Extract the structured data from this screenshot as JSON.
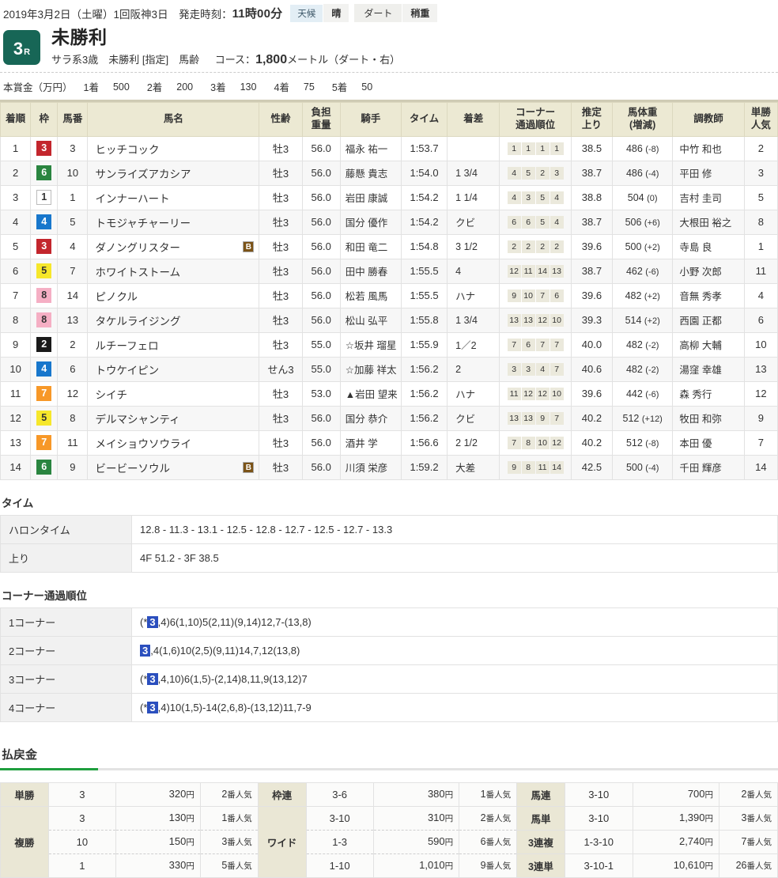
{
  "header": {
    "date_line": "2019年3月2日（土曜）1回阪神3日　発走時刻：",
    "post_time": "11時00分",
    "weather_label": "天候",
    "weather_value": "晴",
    "track_label": "ダート",
    "track_condition": "稍重",
    "race_number": "3",
    "race_number_suffix": "R",
    "race_name": "未勝利",
    "race_sub": "サラ系3歳　未勝利 [指定]　馬齢",
    "course_label": "コース：",
    "course_distance": "1,800",
    "course_unit": "メートル（ダート・右）"
  },
  "prize": {
    "label": "本賞金（万円）",
    "entries": [
      {
        "place": "1着",
        "amount": "500"
      },
      {
        "place": "2着",
        "amount": "200"
      },
      {
        "place": "3着",
        "amount": "130"
      },
      {
        "place": "4着",
        "amount": "75"
      },
      {
        "place": "5着",
        "amount": "50"
      }
    ]
  },
  "result_table": {
    "columns": [
      "着順",
      "枠",
      "馬番",
      "馬名",
      "性齢",
      "負担重量",
      "騎手",
      "タイム",
      "着差",
      "コーナー通過順位",
      "推定上り",
      "馬体重（増減）",
      "調教師",
      "単勝人気"
    ],
    "col_burden_l1": "負担",
    "col_burden_l2": "重量",
    "col_corner_l1": "コーナー",
    "col_corner_l2": "通過順位",
    "col_last_l1": "推定",
    "col_last_l2": "上り",
    "col_bw_l1": "馬体重",
    "col_bw_l2": "(増減)",
    "col_pop_l1": "単勝",
    "col_pop_l2": "人気",
    "rows": [
      {
        "rank": "1",
        "waku": "3",
        "umaban": "3",
        "horse": "ヒッチコック",
        "blinker": "",
        "sex": "牡3",
        "weight": "56.0",
        "jockey": "福永 祐一",
        "time": "1:53.7",
        "margin": "",
        "corner": [
          "1",
          "1",
          "1",
          "1"
        ],
        "last": "38.5",
        "bw": "486",
        "bw_delta": "(-8)",
        "trainer": "中竹 和也",
        "pop": "2"
      },
      {
        "rank": "2",
        "waku": "6",
        "umaban": "10",
        "horse": "サンライズアカシア",
        "blinker": "",
        "sex": "牡3",
        "weight": "56.0",
        "jockey": "藤懸 貴志",
        "time": "1:54.0",
        "margin": "1 3/4",
        "corner": [
          "4",
          "5",
          "2",
          "3"
        ],
        "last": "38.7",
        "bw": "486",
        "bw_delta": "(-4)",
        "trainer": "平田 修",
        "pop": "3"
      },
      {
        "rank": "3",
        "waku": "1",
        "umaban": "1",
        "horse": "インナーハート",
        "blinker": "",
        "sex": "牡3",
        "weight": "56.0",
        "jockey": "岩田 康誠",
        "time": "1:54.2",
        "margin": "1 1/4",
        "corner": [
          "4",
          "3",
          "5",
          "4"
        ],
        "last": "38.8",
        "bw": "504",
        "bw_delta": "(0)",
        "trainer": "吉村 圭司",
        "pop": "5"
      },
      {
        "rank": "4",
        "waku": "4",
        "umaban": "5",
        "horse": "トモジャチャーリー",
        "blinker": "",
        "sex": "牡3",
        "weight": "56.0",
        "jockey": "国分 優作",
        "time": "1:54.2",
        "margin": "クビ",
        "corner": [
          "6",
          "6",
          "5",
          "4"
        ],
        "last": "38.7",
        "bw": "506",
        "bw_delta": "(+6)",
        "trainer": "大根田 裕之",
        "pop": "8"
      },
      {
        "rank": "5",
        "waku": "3",
        "umaban": "4",
        "horse": "ダノングリスター",
        "blinker": "B",
        "sex": "牡3",
        "weight": "56.0",
        "jockey": "和田 竜二",
        "time": "1:54.8",
        "margin": "3 1/2",
        "corner": [
          "2",
          "2",
          "2",
          "2"
        ],
        "last": "39.6",
        "bw": "500",
        "bw_delta": "(+2)",
        "trainer": "寺島 良",
        "pop": "1"
      },
      {
        "rank": "6",
        "waku": "5",
        "umaban": "7",
        "horse": "ホワイトストーム",
        "blinker": "",
        "sex": "牡3",
        "weight": "56.0",
        "jockey": "田中 勝春",
        "time": "1:55.5",
        "margin": "4",
        "corner": [
          "12",
          "11",
          "14",
          "13"
        ],
        "last": "38.7",
        "bw": "462",
        "bw_delta": "(-6)",
        "trainer": "小野 次郎",
        "pop": "11"
      },
      {
        "rank": "7",
        "waku": "8",
        "umaban": "14",
        "horse": "ピノクル",
        "blinker": "",
        "sex": "牡3",
        "weight": "56.0",
        "jockey": "松若 風馬",
        "time": "1:55.5",
        "margin": "ハナ",
        "corner": [
          "9",
          "10",
          "7",
          "6"
        ],
        "last": "39.6",
        "bw": "482",
        "bw_delta": "(+2)",
        "trainer": "音無 秀孝",
        "pop": "4"
      },
      {
        "rank": "8",
        "waku": "8",
        "umaban": "13",
        "horse": "タケルライジング",
        "blinker": "",
        "sex": "牡3",
        "weight": "56.0",
        "jockey": "松山 弘平",
        "time": "1:55.8",
        "margin": "1 3/4",
        "corner": [
          "13",
          "13",
          "12",
          "10"
        ],
        "last": "39.3",
        "bw": "514",
        "bw_delta": "(+2)",
        "trainer": "西園 正都",
        "pop": "6"
      },
      {
        "rank": "9",
        "waku": "2",
        "umaban": "2",
        "horse": "ルチーフェロ",
        "blinker": "",
        "sex": "牡3",
        "weight": "55.0",
        "jockey": "☆坂井 瑠星",
        "time": "1:55.9",
        "margin": "1／2",
        "corner": [
          "7",
          "6",
          "7",
          "7"
        ],
        "last": "40.0",
        "bw": "482",
        "bw_delta": "(-2)",
        "trainer": "高柳 大輔",
        "pop": "10"
      },
      {
        "rank": "10",
        "waku": "4",
        "umaban": "6",
        "horse": "トウケイピン",
        "blinker": "",
        "sex": "せん3",
        "weight": "55.0",
        "jockey": "☆加藤 祥太",
        "time": "1:56.2",
        "margin": "2",
        "corner": [
          "3",
          "3",
          "4",
          "7"
        ],
        "last": "40.6",
        "bw": "482",
        "bw_delta": "(-2)",
        "trainer": "湯窪 幸雄",
        "pop": "13"
      },
      {
        "rank": "11",
        "waku": "7",
        "umaban": "12",
        "horse": "シイチ",
        "blinker": "",
        "sex": "牡3",
        "weight": "53.0",
        "jockey": "▲岩田 望来",
        "time": "1:56.2",
        "margin": "ハナ",
        "corner": [
          "11",
          "12",
          "12",
          "10"
        ],
        "last": "39.6",
        "bw": "442",
        "bw_delta": "(-6)",
        "trainer": "森 秀行",
        "pop": "12"
      },
      {
        "rank": "12",
        "waku": "5",
        "umaban": "8",
        "horse": "デルマシャンティ",
        "blinker": "",
        "sex": "牡3",
        "weight": "56.0",
        "jockey": "国分 恭介",
        "time": "1:56.2",
        "margin": "クビ",
        "corner": [
          "13",
          "13",
          "9",
          "7"
        ],
        "last": "40.2",
        "bw": "512",
        "bw_delta": "(+12)",
        "trainer": "牧田 和弥",
        "pop": "9"
      },
      {
        "rank": "13",
        "waku": "7",
        "umaban": "11",
        "horse": "メイショウソウライ",
        "blinker": "",
        "sex": "牡3",
        "weight": "56.0",
        "jockey": "酒井 学",
        "time": "1:56.6",
        "margin": "2 1/2",
        "corner": [
          "7",
          "8",
          "10",
          "12"
        ],
        "last": "40.2",
        "bw": "512",
        "bw_delta": "(-8)",
        "trainer": "本田 優",
        "pop": "7"
      },
      {
        "rank": "14",
        "waku": "6",
        "umaban": "9",
        "horse": "ビービーソウル",
        "blinker": "B",
        "sex": "牡3",
        "weight": "56.0",
        "jockey": "川須 栄彦",
        "time": "1:59.2",
        "margin": "大差",
        "corner": [
          "9",
          "8",
          "11",
          "14"
        ],
        "last": "42.5",
        "bw": "500",
        "bw_delta": "(-4)",
        "trainer": "千田 輝彦",
        "pop": "14"
      }
    ]
  },
  "time_section": {
    "title": "タイム",
    "rows": [
      {
        "key": "ハロンタイム",
        "value": "12.8 - 11.3 - 13.1 - 12.5 - 12.8 - 12.7 - 12.5 - 12.7 - 13.3"
      },
      {
        "key": "上り",
        "value": "4F 51.2 - 3F 38.5"
      }
    ]
  },
  "corner_section": {
    "title": "コーナー通過順位",
    "rows": [
      {
        "key": "1コーナー",
        "pre": "(*",
        "hl": "3",
        "post": ",4)6(1,10)5(2,11)(9,14)12,7-(13,8)"
      },
      {
        "key": "2コーナー",
        "pre": "",
        "hl": "3",
        "post": ",4(1,6)10(2,5)(9,11)14,7,12(13,8)"
      },
      {
        "key": "3コーナー",
        "pre": "(*",
        "hl": "3",
        "post": ",4,10)6(1,5)-(2,14)8,11,9(13,12)7"
      },
      {
        "key": "4コーナー",
        "pre": "(*",
        "hl": "3",
        "post": ",4)10(1,5)-14(2,6,8)-(13,12)11,7-9"
      }
    ]
  },
  "payout_section": {
    "title": "払戻金",
    "left": [
      {
        "label": "単勝",
        "rowspan": 1,
        "comb": "3",
        "yen": "320",
        "pop": "2"
      },
      {
        "label": "複勝",
        "rowspan": 3,
        "comb": "3",
        "yen": "130",
        "pop": "1"
      },
      {
        "label": "",
        "rowspan": 0,
        "comb": "10",
        "yen": "150",
        "pop": "3"
      },
      {
        "label": "",
        "rowspan": 0,
        "comb": "1",
        "yen": "330",
        "pop": "5"
      }
    ],
    "right": [
      {
        "label": "枠連",
        "rowspan": 1,
        "comb": "3-6",
        "yen": "380",
        "pop": "1"
      },
      {
        "label": "ワイド",
        "rowspan": 3,
        "comb": "3-10",
        "yen": "310",
        "pop": "2"
      },
      {
        "label": "",
        "rowspan": 0,
        "comb": "1-3",
        "yen": "590",
        "pop": "6"
      },
      {
        "label": "",
        "rowspan": 0,
        "comb": "1-10",
        "yen": "1,010",
        "pop": "9"
      }
    ],
    "far": [
      {
        "label": "馬連",
        "comb": "3-10",
        "yen": "700",
        "pop": "2"
      },
      {
        "label": "馬単",
        "comb": "3-10",
        "yen": "1,390",
        "pop": "3"
      },
      {
        "label": "3連複",
        "comb": "1-3-10",
        "yen": "2,740",
        "pop": "7"
      },
      {
        "label": "3連単",
        "comb": "3-10-1",
        "yen": "10,610",
        "pop": "26"
      }
    ],
    "yen_unit": "円",
    "pop_unit": "番人気"
  }
}
